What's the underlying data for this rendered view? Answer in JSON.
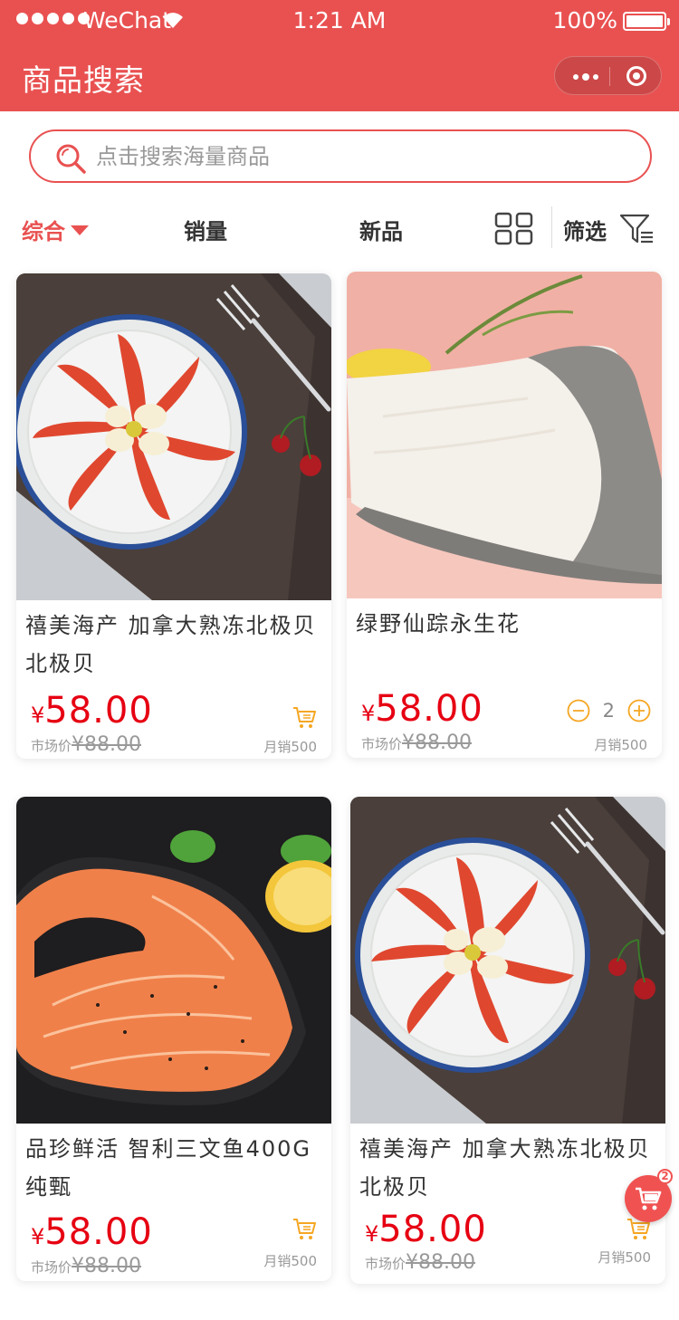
{
  "status_bar": {
    "carrier": "WeChat",
    "time": "1:21 AM",
    "battery": "100%"
  },
  "nav": {
    "title": "商品搜索"
  },
  "search": {
    "placeholder": "点击搜索海量商品",
    "value": ""
  },
  "sort": {
    "comprehensive": "综合",
    "sales": "销量",
    "new": "新品",
    "filter": "筛选",
    "active": "comprehensive"
  },
  "accent_color": "#e95151",
  "price_color": "#e60012",
  "products": [
    {
      "title": "禧美海产 加拿大熟冻北极贝北极贝",
      "yen": "¥",
      "price": "58.00",
      "market_label": "市场价",
      "market_price": "¥88.00",
      "sales": "月销500",
      "image": "scallop-plate"
    },
    {
      "title": "绿野仙踪永生花",
      "yen": "¥",
      "price": "58.00",
      "market_label": "市场价",
      "market_price": "¥88.00",
      "sales": "月销500",
      "image": "cod-steak",
      "quantity": "2"
    },
    {
      "title": "品珍鲜活 智利三文鱼400G纯甄",
      "yen": "¥",
      "price": "58.00",
      "market_label": "市场价",
      "market_price": "¥88.00",
      "sales": "月销500",
      "image": "salmon-steak"
    },
    {
      "title": "禧美海产 加拿大熟冻北极贝北极贝",
      "yen": "¥",
      "price": "58.00",
      "market_label": "市场价",
      "market_price": "¥88.00",
      "sales": "月销500",
      "image": "scallop-plate"
    }
  ],
  "cart": {
    "count": "2"
  }
}
